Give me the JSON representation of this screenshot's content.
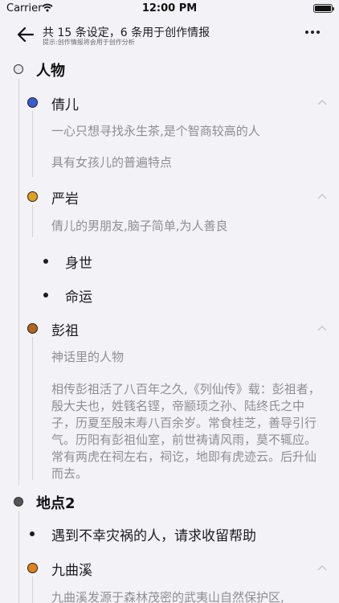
{
  "status": {
    "carrier": "Carrier",
    "time": "12:00 PM"
  },
  "nav": {
    "title": "共 15 条设定，6 条用于创作情报",
    "subtitle": "提示:创作情报将会用于创作分析"
  },
  "sections": [
    {
      "title": "人物",
      "items": [
        {
          "name": "倩儿",
          "icon_color": "#3b5bd6",
          "descriptions": [
            "一心只想寻找永生茶,是个智商较高的人",
            "具有女孩儿的普遍特点"
          ]
        },
        {
          "name": "严岩",
          "icon_color": "#e0a21b",
          "descriptions": [
            "倩儿的男朋友,脑子简单,为人善良"
          ],
          "bullets": [
            "身世",
            "命运"
          ]
        },
        {
          "name": "彭祖",
          "icon_color": "#b5651d",
          "descriptions": [
            "神话里的人物",
            "相传彭祖活了八百年之久,《列仙传》载：彭祖者，殷大夫也，姓篯名铿，帝颛顼之孙、陆终氏之中子，历夏至殷末寿八百余岁。常食桂芝，善导引行气。历阳有彭祖仙室，前世祷请风雨，莫不辄应。常有两虎在祠左右，祠讫，地即有虎迹云。后升仙而去。"
          ]
        }
      ]
    },
    {
      "title": "地点2",
      "bullets": [
        "遇到不幸灾祸的人，请求收留帮助"
      ],
      "items": [
        {
          "name": "九曲溪",
          "icon_color": "#e0821b",
          "descriptions": [
            "九曲溪发源于森林茂密的武夷山自然保护区,"
          ]
        }
      ]
    }
  ]
}
